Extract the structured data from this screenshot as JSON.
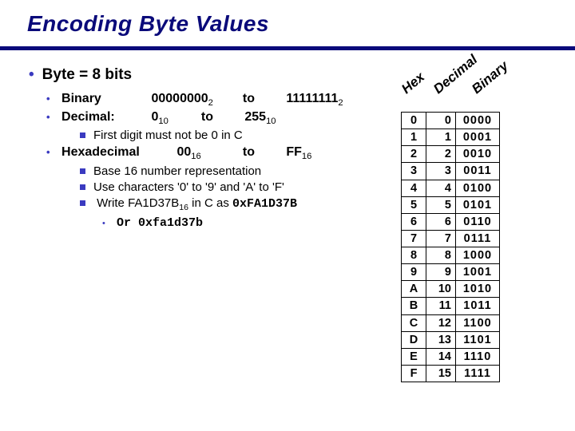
{
  "title": "Encoding Byte Values",
  "bullet1": "Byte = 8 bits",
  "binary": {
    "label": "Binary",
    "from_digits": "00000000",
    "from_sub": "2",
    "to_word": "to",
    "to_digits": "11111111",
    "to_sub": "2"
  },
  "decimal": {
    "label": "Decimal:",
    "from_digits": "0",
    "from_sub": "10",
    "to_word": "to",
    "to_digits": "255",
    "to_sub": "10"
  },
  "dec_note": "First digit must not be 0 in C",
  "hex": {
    "label": "Hexadecimal",
    "from_digits": "00",
    "from_sub": "16",
    "to_word": "to",
    "to_digits": "FF",
    "to_sub": "16"
  },
  "hex_notes": {
    "a": "Base 16 number representation",
    "b": "Use characters '0' to '9' and 'A' to 'F'",
    "c_pre": "Write FA1D37B",
    "c_sub": "16",
    "c_mid": " in C as ",
    "c_code": "0xFA1D37B"
  },
  "or_label": "Or ",
  "or_code": "0xfa1d37b",
  "headers": {
    "hex": "Hex",
    "dec": "Decimal",
    "bin": "Binary"
  },
  "rows": [
    {
      "h": "0",
      "d": "0",
      "b": "0000"
    },
    {
      "h": "1",
      "d": "1",
      "b": "0001"
    },
    {
      "h": "2",
      "d": "2",
      "b": "0010"
    },
    {
      "h": "3",
      "d": "3",
      "b": "0011"
    },
    {
      "h": "4",
      "d": "4",
      "b": "0100"
    },
    {
      "h": "5",
      "d": "5",
      "b": "0101"
    },
    {
      "h": "6",
      "d": "6",
      "b": "0110"
    },
    {
      "h": "7",
      "d": "7",
      "b": "0111"
    },
    {
      "h": "8",
      "d": "8",
      "b": "1000"
    },
    {
      "h": "9",
      "d": "9",
      "b": "1001"
    },
    {
      "h": "A",
      "d": "10",
      "b": "1010"
    },
    {
      "h": "B",
      "d": "11",
      "b": "1011"
    },
    {
      "h": "C",
      "d": "12",
      "b": "1100"
    },
    {
      "h": "D",
      "d": "13",
      "b": "1101"
    },
    {
      "h": "E",
      "d": "14",
      "b": "1110"
    },
    {
      "h": "F",
      "d": "15",
      "b": "1111"
    }
  ]
}
